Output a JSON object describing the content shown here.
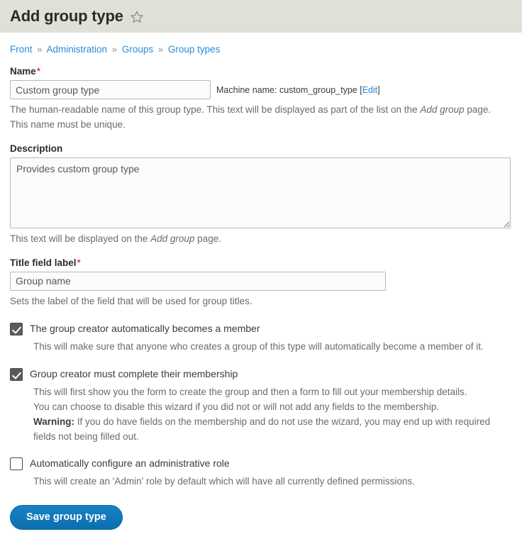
{
  "header": {
    "title": "Add group type",
    "star_icon": "star-outline-icon"
  },
  "breadcrumb": {
    "separator": "»",
    "items": [
      {
        "label": "Front"
      },
      {
        "label": "Administration"
      },
      {
        "label": "Groups"
      },
      {
        "label": "Group types"
      }
    ]
  },
  "form": {
    "name": {
      "label": "Name",
      "required_mark": "*",
      "value": "Custom group type",
      "placeholder": "",
      "machine_name_prefix": "Machine name: ",
      "machine_name_value": "custom_group_type",
      "machine_name_bracket_open": " [",
      "machine_name_edit": "Edit",
      "machine_name_bracket_close": "]",
      "help": "The human-readable name of this group type. This text will be displayed as part of the list on the ",
      "help_em": "Add group",
      "help_tail": " page. This name must be unique."
    },
    "description": {
      "label": "Description",
      "value": "Provides custom group type",
      "placeholder": "",
      "help": "This text will be displayed on the ",
      "help_em": "Add group",
      "help_tail": " page."
    },
    "title_field_label": {
      "label": "Title field label",
      "required_mark": "*",
      "value": "Group name",
      "placeholder": "",
      "help": "Sets the label of the field that will be used for group titles."
    },
    "checkbox_creator_member": {
      "label": "The group creator automatically becomes a member",
      "checked": true,
      "help": "This will make sure that anyone who creates a group of this type will automatically become a member of it."
    },
    "checkbox_complete_membership": {
      "label": "Group creator must complete their membership",
      "checked": true,
      "help_line1": "This will first show you the form to create the group and then a form to fill out your membership details.",
      "help_line2": "You can choose to disable this wizard if you did not or will not add any fields to the membership.",
      "warning_label": "Warning:",
      "help_line3": " If you do have fields on the membership and do not use the wizard, you may end up with required fields not being filled out."
    },
    "checkbox_admin_role": {
      "label": "Automatically configure an administrative role",
      "checked": false,
      "help": "This will create an 'Admin' role by default which will have all currently defined permissions."
    },
    "submit_label": "Save group type"
  },
  "colors": {
    "header_band": "#e0e0d8",
    "link": "#2a8bd8",
    "required": "#e30000",
    "button": "#0b6fae",
    "checkbox_checked": "#5a5a5a",
    "help_text": "#6b6b6b"
  }
}
